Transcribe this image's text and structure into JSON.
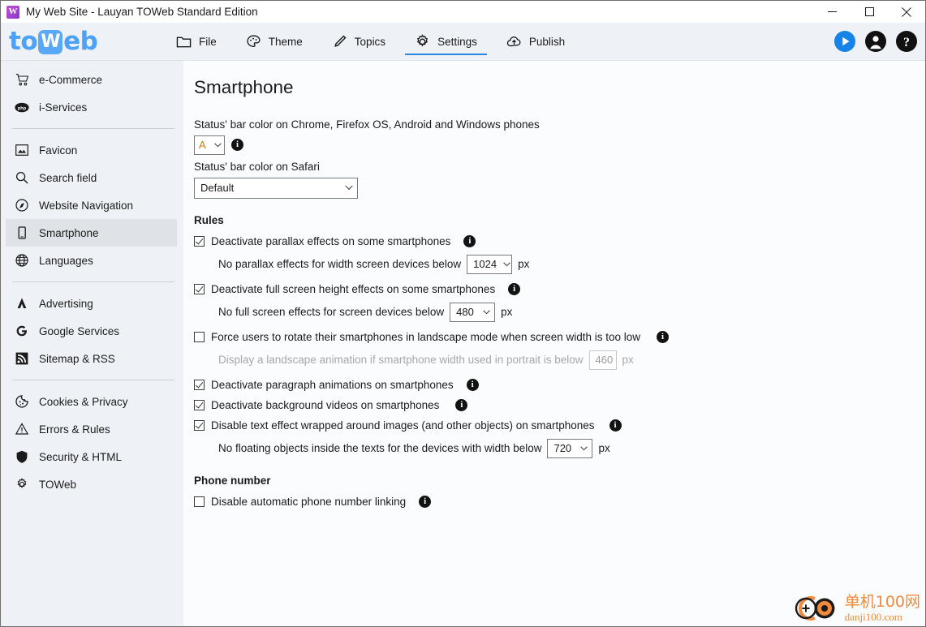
{
  "window": {
    "title": "My Web Site - Lauyan TOWeb Standard Edition",
    "app_icon": "toweb-app-icon",
    "minimize_label": "Minimize",
    "maximize_label": "Maximize",
    "close_label": "Close"
  },
  "toolbar": {
    "logo_part1": "to",
    "logo_part2": "W",
    "logo_part3": "eb",
    "tabs": [
      {
        "label": "File",
        "icon": "folder-icon",
        "active": false
      },
      {
        "label": "Theme",
        "icon": "palette-icon",
        "active": false
      },
      {
        "label": "Topics",
        "icon": "pencil-icon",
        "active": false
      },
      {
        "label": "Settings",
        "icon": "gear-icon",
        "active": true
      },
      {
        "label": "Publish",
        "icon": "cloud-upload-icon",
        "active": false
      }
    ],
    "preview_label": "Preview",
    "account_label": "Account",
    "help_label": "Help",
    "accent_color": "#1683e8"
  },
  "sidebar": {
    "items": [
      {
        "label": "e-Commerce",
        "icon": "shopping-cart-icon",
        "selected": false
      },
      {
        "label": "i-Services",
        "icon": "php-icon",
        "selected": false
      },
      {
        "separator": true
      },
      {
        "label": "Favicon",
        "icon": "image-icon",
        "selected": false
      },
      {
        "label": "Search field",
        "icon": "search-icon",
        "selected": false
      },
      {
        "label": "Website Navigation",
        "icon": "compass-icon",
        "selected": false
      },
      {
        "label": "Smartphone",
        "icon": "smartphone-icon",
        "selected": true
      },
      {
        "label": "Languages",
        "icon": "globe-icon",
        "selected": false
      },
      {
        "separator": true
      },
      {
        "label": "Advertising",
        "icon": "adsense-icon",
        "selected": false
      },
      {
        "label": "Google Services",
        "icon": "google-g-icon",
        "selected": false
      },
      {
        "label": "Sitemap & RSS",
        "icon": "rss-icon",
        "selected": false
      },
      {
        "separator": true
      },
      {
        "label": "Cookies & Privacy",
        "icon": "cookie-icon",
        "selected": false
      },
      {
        "label": "Errors & Rules",
        "icon": "warning-triangle-icon",
        "selected": false
      },
      {
        "label": "Security & HTML",
        "icon": "shield-icon",
        "selected": false
      },
      {
        "label": "TOWeb",
        "icon": "gear-icon",
        "selected": false
      }
    ]
  },
  "main": {
    "page_title": "Smartphone",
    "statusbar_chrome": {
      "label": "Status' bar color on Chrome, Firefox OS, Android and Windows phones",
      "value": "A",
      "info": "i",
      "swatch_color": "#c87e16"
    },
    "statusbar_safari": {
      "label": "Status' bar color on Safari",
      "value": "Default"
    },
    "rules_heading": "Rules",
    "rules": [
      {
        "label": "Deactivate parallax effects on some smartphones",
        "checked": true,
        "info": "i",
        "sub_label": "No parallax effects for width screen devices below",
        "sub_value": "1024",
        "unit": "px",
        "sub_disabled": false
      },
      {
        "label": "Deactivate full screen height effects on some smartphones",
        "checked": true,
        "info": "i",
        "sub_label": "No full screen effects for screen devices below",
        "sub_value": "480",
        "unit": "px",
        "sub_disabled": false
      },
      {
        "label": "Force users to rotate their smartphones in landscape mode when screen width is too low",
        "checked": false,
        "info": "i",
        "sub_label": "Display a landscape animation if smartphone width used in portrait is below",
        "sub_value": "460",
        "unit": "px",
        "sub_disabled": true
      },
      {
        "label": "Deactivate paragraph animations on smartphones",
        "checked": true,
        "info": "i",
        "sub_label": null,
        "sub_value": null,
        "unit": null,
        "sub_disabled": false
      },
      {
        "label": "Deactivate background videos on smartphones",
        "checked": true,
        "info": "i",
        "sub_label": null,
        "sub_value": null,
        "unit": null,
        "sub_disabled": false
      },
      {
        "label": "Disable text effect wrapped around images (and other objects) on smartphones",
        "checked": true,
        "info": "i",
        "sub_label": "No floating objects inside the texts for the devices with width below",
        "sub_value": "720",
        "unit": "px",
        "sub_disabled": false
      }
    ],
    "phone_heading": "Phone number",
    "phone_rule": {
      "label": "Disable automatic phone number linking",
      "checked": false,
      "info": "i"
    }
  },
  "watermark": {
    "cn": "单机100网",
    "en": "danji100.com",
    "color": "#f08a3c"
  }
}
